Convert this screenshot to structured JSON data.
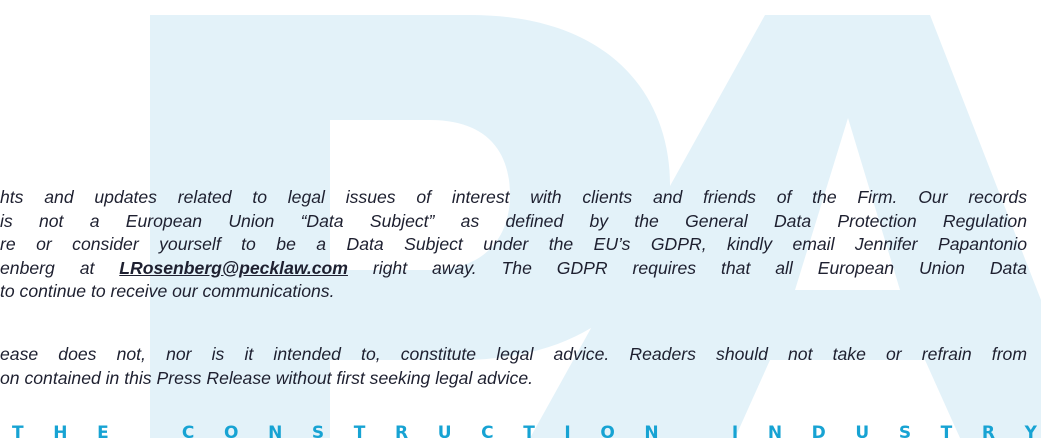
{
  "colors": {
    "watermark": "#e3f2f9",
    "text": "#1e2030",
    "tagline": "#17a3d3"
  },
  "watermark": {
    "logo": "P&A"
  },
  "paragraph_1": {
    "line_1": "hts and updates related to legal issues of interest with clients and friends of the Firm. Our records",
    "line_2": " is not a European Union “Data Subject” as defined by the General Data Protection Regulation",
    "line_3": "re or consider yourself to be a Data Subject under the EU’s GDPR, kindly email Jennifer Papantonio",
    "line_4_before": "enberg at ",
    "email": "LRosenberg@pecklaw.com",
    "line_4_after": " right away. The GDPR requires that all European Union Data",
    "line_5": " to continue to receive our communications."
  },
  "paragraph_2": {
    "line_1": "ease does not, nor is it intended to, constitute legal advice.  Readers should not take or refrain from",
    "line_2": "on contained in this Press Release without first seeking legal advice."
  },
  "tagline": {
    "text": "THE CONSTRUCTION INDUSTRY"
  }
}
